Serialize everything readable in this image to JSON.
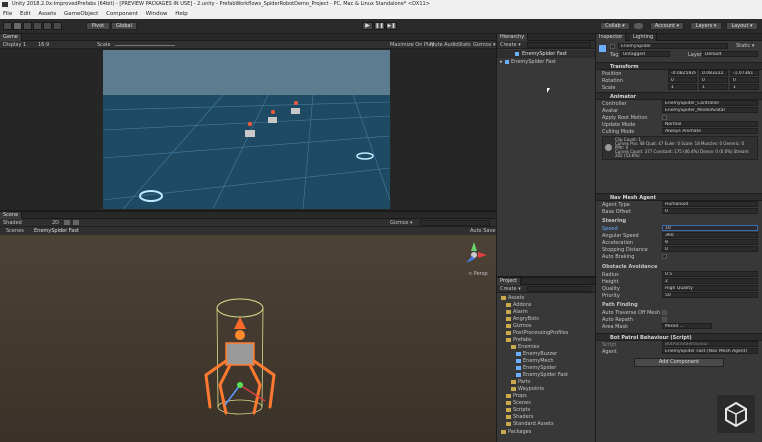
{
  "window": {
    "title": "Unity 2018.2.0x-ImprovedPrefabs (64bit) - [PREVIEW PACKAGES IN USE] - 2.unity - PrefabWorkflows_SpiderRobotDemo_Project - PC, Mac & Linux Standalone* <DX11>"
  },
  "menu": [
    "File",
    "Edit",
    "Assets",
    "GameObject",
    "Component",
    "Window",
    "Help"
  ],
  "toolbar": {
    "pivot": "Pivot",
    "global": "Global",
    "collab": "Collab ▾",
    "account": "Account ▾",
    "layers": "Layers ▾",
    "layout": "Layout ▾"
  },
  "game": {
    "tab": "Game",
    "display": "Display 1",
    "aspect": "16:9",
    "scale": "Scale",
    "opts": [
      "Maximize On Play",
      "Mute Audio",
      "Stats",
      "Gizmos ▾"
    ]
  },
  "scene": {
    "tab": "Scene",
    "shading": "Shaded",
    "mode": "2D",
    "gizmos": "Gizmos ▾",
    "breadcrumb_root": "Scenes",
    "breadcrumb_item": "EnemySpider Fast",
    "auto_save": "Auto Save",
    "persp": "< Persp"
  },
  "hierarchy": {
    "tab": "Hierarchy",
    "create": "Create ▾",
    "root": "EnemySpider Fast",
    "item": "EnemySpider Fast"
  },
  "project": {
    "tab": "Project",
    "create": "Create ▾",
    "tree": [
      {
        "label": "Assets",
        "indent": 0
      },
      {
        "label": "Addons",
        "indent": 1
      },
      {
        "label": "Alarm",
        "indent": 1
      },
      {
        "label": "AngryBots",
        "indent": 1
      },
      {
        "label": "Gizmos",
        "indent": 1
      },
      {
        "label": "PostProcessingProfiles",
        "indent": 1
      },
      {
        "label": "Prefabs",
        "indent": 1
      },
      {
        "label": "Enemies",
        "indent": 2
      },
      {
        "label": "EnemyBuzzer",
        "indent": 3
      },
      {
        "label": "EnemyMech",
        "indent": 3
      },
      {
        "label": "EnemySpider",
        "indent": 3
      },
      {
        "label": "EnemySpider Fast",
        "indent": 3
      },
      {
        "label": "Parts",
        "indent": 2
      },
      {
        "label": "Waypoints",
        "indent": 2
      },
      {
        "label": "Props",
        "indent": 1
      },
      {
        "label": "Scenes",
        "indent": 1
      },
      {
        "label": "Scripts",
        "indent": 1
      },
      {
        "label": "Shaders",
        "indent": 1
      },
      {
        "label": "Standard Assets",
        "indent": 1
      },
      {
        "label": "Packages",
        "indent": 0
      }
    ]
  },
  "inspector": {
    "tabs": [
      "Inspector",
      "Lighting"
    ],
    "object_name": "EnemySpider",
    "static": "Static ▾",
    "tag_label": "Tag",
    "tag_value": "Untagged",
    "layer_label": "Layer",
    "layer_value": "Default",
    "transform": {
      "title": "Transform",
      "rows": [
        {
          "label": "Position",
          "x": "-0.0825929",
          "y": "0.083222",
          "z": "-1.07361"
        },
        {
          "label": "Rotation",
          "x": "0",
          "y": "0",
          "z": "0"
        },
        {
          "label": "Scale",
          "x": "1",
          "y": "1",
          "z": "1"
        }
      ]
    },
    "animator": {
      "title": "Animator",
      "rows": [
        {
          "label": "Controller",
          "value": "EnemySpider_Controller"
        },
        {
          "label": "Avatar",
          "value": "EnemySpider_ModelAvatar"
        },
        {
          "label": "Apply Root Motion",
          "value": ""
        },
        {
          "label": "Update Mode",
          "value": "Normal"
        },
        {
          "label": "Culling Mode",
          "value": "Always Animate"
        }
      ],
      "info": [
        "Clip Count: 1",
        "Curves Pos: 48 Quat: 47 Euler: 0 Scale: 18 Muscles: 0 Generic: 0",
        "PPtr: 0",
        "Curves Count: 377 Constant: 175 (46.4%) Dense: 0 (0.0%) Stream:",
        "202 (53.6%)"
      ]
    },
    "nav": {
      "title": "Nav Mesh Agent",
      "rows": [
        {
          "label": "Agent Type",
          "value": "Humanoid"
        },
        {
          "label": "Base Offset",
          "value": "0"
        }
      ],
      "steering_title": "Steering",
      "steering": [
        {
          "label": "Speed",
          "value": "10"
        },
        {
          "label": "Angular Speed",
          "value": "360"
        },
        {
          "label": "Acceleration",
          "value": "8"
        },
        {
          "label": "Stopping Distance",
          "value": "0"
        },
        {
          "label": "Auto Braking",
          "value": ""
        }
      ],
      "avoid_title": "Obstacle Avoidance",
      "avoid": [
        {
          "label": "Radius",
          "value": "0.5"
        },
        {
          "label": "Height",
          "value": "2"
        },
        {
          "label": "Quality",
          "value": "High Quality"
        },
        {
          "label": "Priority",
          "value": "50"
        }
      ],
      "path_title": "Path Finding",
      "path": [
        {
          "label": "Auto Traverse Off Mesh Li",
          "value": ""
        },
        {
          "label": "Auto Repath",
          "value": ""
        },
        {
          "label": "Area Mask",
          "value": "Mixed ..."
        }
      ]
    },
    "bot": {
      "title": "Bot Patrol Behaviour (Script)",
      "script_label": "Script",
      "script_value": "BotPatrolBehaviour",
      "agent_label": "Agent",
      "agent_value": "EnemySpider Fast (Nav Mesh Agent)"
    },
    "add_component": "Add Component"
  }
}
